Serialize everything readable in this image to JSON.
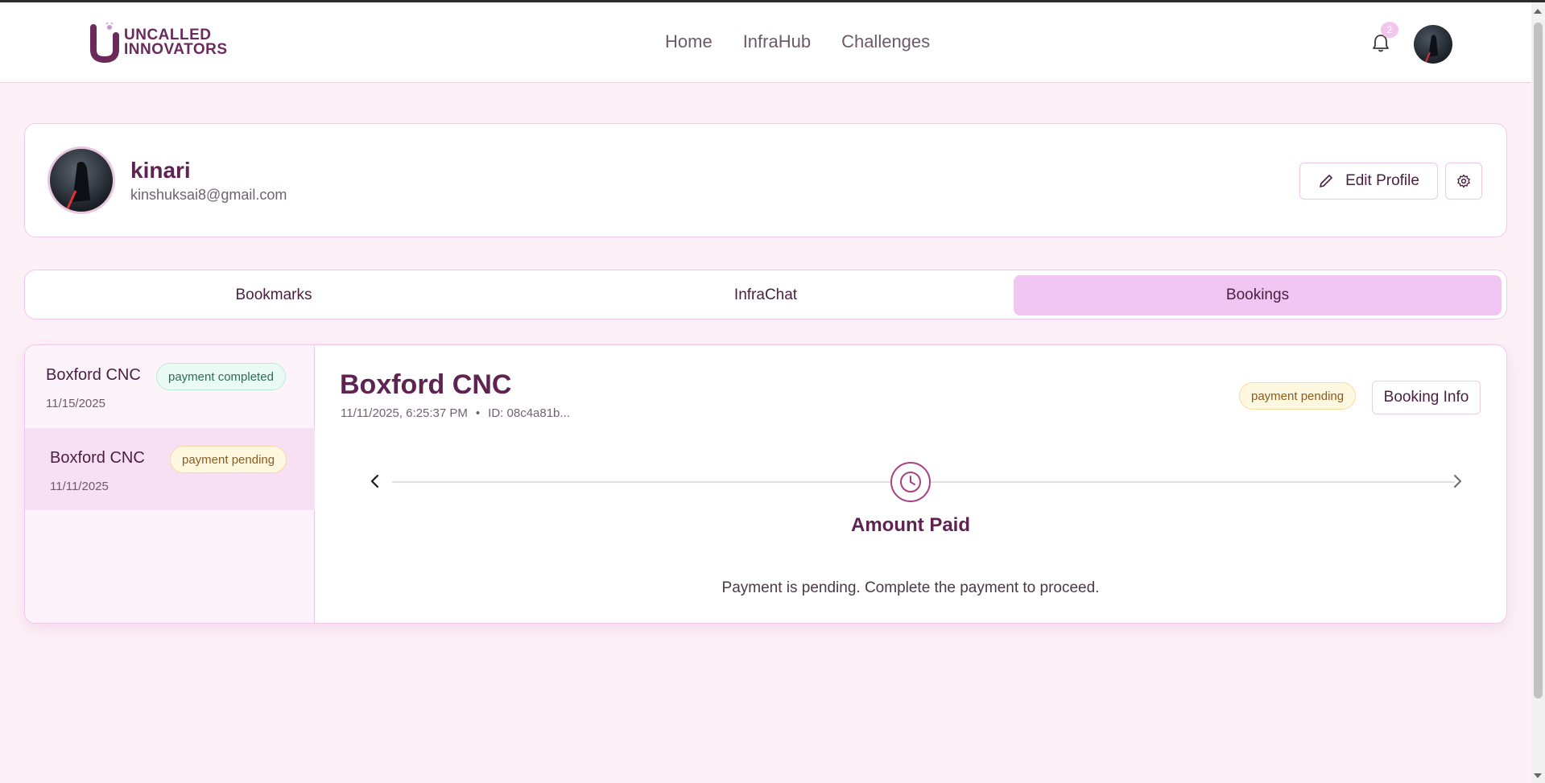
{
  "brand": {
    "line1": "UNCALLED",
    "line2": "INNOVATORS"
  },
  "nav": {
    "links": [
      "Home",
      "InfraHub",
      "Challenges"
    ]
  },
  "notifications": {
    "count": "2"
  },
  "icons": {
    "bell": "bell-icon",
    "pencil": "pencil-icon",
    "gear": "gear-icon",
    "clock": "clock-icon",
    "chevron_left": "chevron-left-icon",
    "chevron_right": "chevron-right-icon"
  },
  "colors": {
    "accent": "#f2c6f2",
    "primary_text": "#5e2350",
    "background": "#fdf0f7"
  },
  "profile": {
    "name": "kinari",
    "email": "kinshuksai8@gmail.com",
    "edit_label": "Edit Profile"
  },
  "tabs": [
    {
      "label": "Bookmarks"
    },
    {
      "label": "InfraChat"
    },
    {
      "label": "Bookings",
      "active": true
    }
  ],
  "bookings": [
    {
      "title": "Boxford CNC",
      "status": "payment completed",
      "date": "11/15/2025"
    },
    {
      "title": "Boxford CNC",
      "status": "payment pending",
      "date": "11/11/2025",
      "selected": true
    }
  ],
  "detail": {
    "title": "Boxford CNC",
    "datetime": "11/11/2025, 6:25:37 PM",
    "separator": "•",
    "id": "ID: 08c4a81b...",
    "status": "payment pending",
    "info_button": "Booking Info",
    "step_label": "Amount Paid",
    "message": "Payment is pending. Complete the payment to proceed."
  }
}
